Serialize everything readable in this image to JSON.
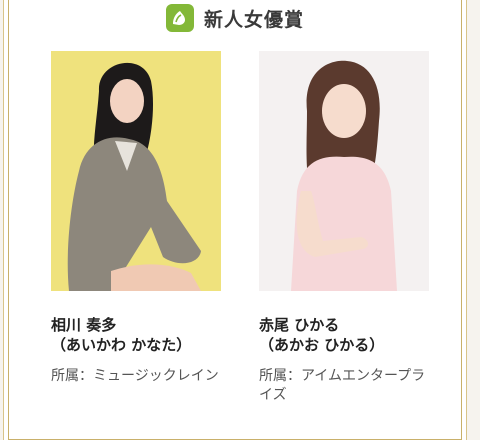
{
  "section": {
    "title": "新人女優賞",
    "icon": "award-icon",
    "accent": "#83b838"
  },
  "winners": [
    {
      "name": "相川 奏多",
      "kana": "（あいかわ かなた）",
      "agency": "所属：ミュージックレイン"
    },
    {
      "name": "赤尾 ひかる",
      "kana": "（あかお ひかる）",
      "agency": "所属：アイムエンタープライズ"
    }
  ]
}
